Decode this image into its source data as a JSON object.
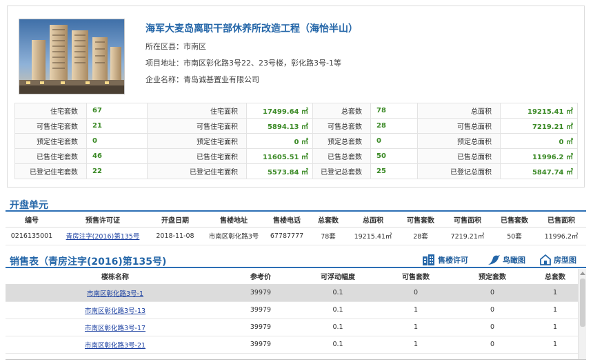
{
  "project": {
    "title": "海军大麦岛离职干部休养所改造工程（海怡半山）",
    "district_label": "所在区县：",
    "district": "市南区",
    "address_label": "项目地址：",
    "address": "市南区彰化路3号22、23号楼，彰化路3号-1等",
    "company_label": "企业名称：",
    "company": "青岛诚基置业有限公司"
  },
  "stats": [
    [
      "住宅套数",
      "67",
      "住宅面积",
      "17499.64 ㎡",
      "总套数",
      "78",
      "总面积",
      "19215.41 ㎡"
    ],
    [
      "可售住宅套数",
      "21",
      "可售住宅面积",
      "5894.13 ㎡",
      "可售总套数",
      "28",
      "可售总面积",
      "7219.21 ㎡"
    ],
    [
      "预定住宅套数",
      "0",
      "预定住宅面积",
      "0 ㎡",
      "预定总套数",
      "0",
      "预定总面积",
      "0 ㎡"
    ],
    [
      "已售住宅套数",
      "46",
      "已售住宅面积",
      "11605.51 ㎡",
      "已售总套数",
      "50",
      "已售总面积",
      "11996.2 ㎡"
    ],
    [
      "已登记住宅套数",
      "22",
      "已登记住宅面积",
      "5573.84 ㎡",
      "已登记总套数",
      "25",
      "已登记总面积",
      "5847.74 ㎡"
    ]
  ],
  "opening": {
    "title": "开盘单元",
    "headers": [
      "编号",
      "预售许可证",
      "开盘日期",
      "售楼地址",
      "售楼电话",
      "总套数",
      "总面积",
      "可售套数",
      "可售面积",
      "已售套数",
      "已售面积"
    ],
    "row": {
      "id": "0216135001",
      "permit": "青房注字(2016)第135号",
      "date": "2018-11-08",
      "sales_address": "市南区彰化路3号",
      "phone": "67787777",
      "total_units": "78套",
      "total_area": "19215.41㎡",
      "avail_units": "28套",
      "avail_area": "7219.21㎡",
      "sold_units": "50套",
      "sold_area": "11996.2㎡"
    }
  },
  "sales": {
    "title": "销售表（青房注字(2016)第135号)",
    "tools": {
      "permit": "售楼许可",
      "bird": "鸟瞰图",
      "house": "房型图"
    },
    "headers": [
      "楼栋名称",
      "参考价",
      "可浮动幅度",
      "可售套数",
      "预定套数",
      "总套数"
    ],
    "rows": [
      {
        "name": "市南区彰化路3号-1",
        "price": "39979",
        "float": "0.1",
        "avail": "0",
        "reserved": "0",
        "total": "1"
      },
      {
        "name": "市南区彰化路3号-13",
        "price": "39979",
        "float": "0.1",
        "avail": "1",
        "reserved": "0",
        "total": "1"
      },
      {
        "name": "市南区彰化路3号-17",
        "price": "39979",
        "float": "0.1",
        "avail": "1",
        "reserved": "0",
        "total": "1"
      },
      {
        "name": "市南区彰化路3号-21",
        "price": "39979",
        "float": "0.1",
        "avail": "1",
        "reserved": "0",
        "total": "1"
      }
    ]
  },
  "colors": {
    "accent": "#2466a8",
    "number": "#3b8a26",
    "link": "#1a3fa0",
    "selected_row": "#dcdcdc"
  },
  "icons": [
    "building-photo",
    "permit-icon",
    "bird-icon",
    "house-icon"
  ]
}
